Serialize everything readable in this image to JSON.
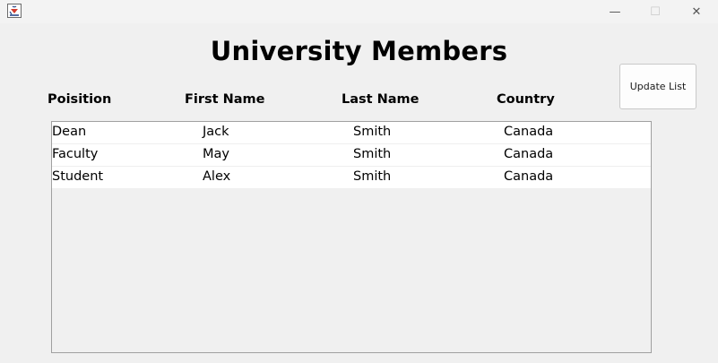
{
  "window": {
    "app_icon": "java-cup-icon",
    "controls": {
      "minimize": "—",
      "maximize": "☐",
      "close": "✕"
    }
  },
  "title": "University Members",
  "update_button": "Update List",
  "columns": [
    "Poisition",
    "First Name",
    "Last Name",
    "Country"
  ],
  "rows": [
    {
      "position": "Dean",
      "first": "Jack",
      "last": "Smith",
      "country": "Canada"
    },
    {
      "position": "Faculty",
      "first": "May",
      "last": "Smith",
      "country": "Canada"
    },
    {
      "position": "Student",
      "first": "Alex",
      "last": "Smith",
      "country": "Canada"
    }
  ]
}
